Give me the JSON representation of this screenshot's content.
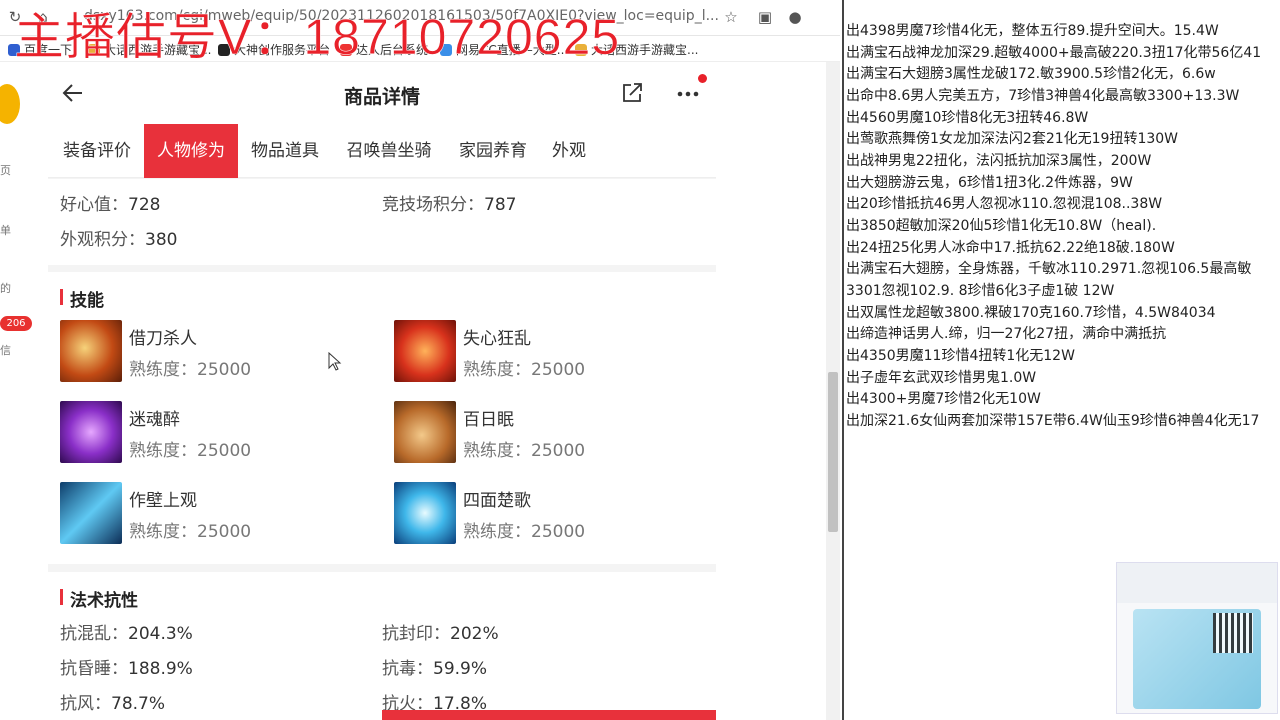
{
  "watermark": {
    "text": "主播估号V：18710720625",
    "color": "#e8212a"
  },
  "browser": {
    "url_text": "dsxy163.com/cgi/mweb/equip/50/2023112602018161503/50f7A0XIE0?view_loc=equip_l...",
    "bookmarks": [
      "百度一下",
      "大话西游手游藏宝...",
      "大神创作服务平台",
      "达人后台系统",
      "网易CC直播—大型...",
      "大话西游手游藏宝..."
    ]
  },
  "left_strip": {
    "items": [
      "页",
      "单",
      "的",
      "信"
    ],
    "badge": "206"
  },
  "page": {
    "title": "商品详情",
    "tabs": [
      "装备评价",
      "人物修为",
      "物品道具",
      "召唤兽坐骑",
      "家园养育",
      "外观"
    ],
    "active_tab": 1,
    "stats": {
      "heart_label": "好心值：",
      "heart_value": "728",
      "arena_label": "竞技场积分：",
      "arena_value": "787",
      "appearance_label": "外观积分：",
      "appearance_value": "380"
    },
    "skills_title": "技能",
    "skills": [
      {
        "name": "借刀杀人",
        "prof_label": "熟练度：",
        "prof": "25000",
        "icon": "blade-skill-icon"
      },
      {
        "name": "失心狂乱",
        "prof_label": "熟练度：",
        "prof": "25000",
        "icon": "frenzy-skill-icon"
      },
      {
        "name": "迷魂醉",
        "prof_label": "熟练度：",
        "prof": "25000",
        "icon": "charm-skill-icon"
      },
      {
        "name": "百日眠",
        "prof_label": "熟练度：",
        "prof": "25000",
        "icon": "sleep-skill-icon"
      },
      {
        "name": "作壁上观",
        "prof_label": "熟练度：",
        "prof": "25000",
        "icon": "ice-skill-icon"
      },
      {
        "name": "四面楚歌",
        "prof_label": "熟练度：",
        "prof": "25000",
        "icon": "siege-skill-icon"
      }
    ],
    "resist_title": "法术抗性",
    "resists": [
      {
        "label": "抗混乱：",
        "value": "204.3%"
      },
      {
        "label": "抗封印：",
        "value": "202%"
      },
      {
        "label": "抗昏睡：",
        "value": "188.9%"
      },
      {
        "label": "抗毒：",
        "value": "59.9%"
      },
      {
        "label": "抗风：",
        "value": "78.7%"
      },
      {
        "label": "抗火：",
        "value": "17.8%"
      }
    ],
    "accent": "#e8313b"
  },
  "notes": [
    "出4398男魔7珍惜4化无，整体五行89.提升空间大。15.4W",
    "出满宝石战神龙加深29.超敏4000+最高破220.3扭17化带56亿41",
    "出满宝石大翅膀3属性龙破172.敏3900.5珍惜2化无，6.6w",
    "出命中8.6男人完美五方，7珍惜3神兽4化最高敏3300+13.3W",
    "出4560男魔10珍惜8化无3扭转46.8W",
    "出莺歌燕舞傍1女龙加深法闪2套21化无19扭转130W",
    "出战神男鬼22扭化，法闪抵抗加深3属性，200W",
    "出大翅膀游云鬼，6珍惜1扭3化.2件炼器，9W",
    "出20珍惜抵抗46男人忽视冰110.忽视混108..38W",
    "出3850超敏加深20仙5珍惜1化无10.8W（heal).",
    "出24扭25化男人冰命中17.抵抗62.22绝18破.180W",
    "出满宝石大翅膀，全身炼器，千敏冰110.2971.忽视106.5最高敏",
    "3301忽视102.9. 8珍惜6化3子虚1破  12W",
    "出双属性龙超敏3800.裸破170克160.7珍惜，4.5W84034",
    "出缔造神话男人.缔，归一27化27扭，满命中满抵抗",
    "出4350男魔11珍惜4扭转1化无12W",
    "出子虚年玄武双珍惜男鬼1.0W",
    "出4300+男魔7珍惜2化无10W",
    "出加深21.6女仙两套加深带157E带6.4W仙玉9珍惜6神兽4化无17"
  ]
}
